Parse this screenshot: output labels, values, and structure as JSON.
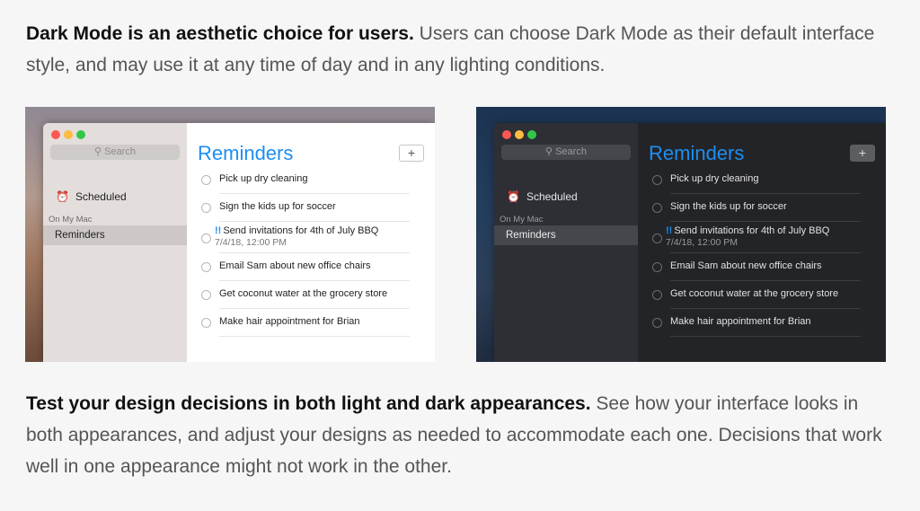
{
  "intro": {
    "bold": "Dark Mode is an aesthetic choice for users.",
    "text": " Users can choose Dark Mode as their default interface style, and may use it at any time of day and in any lighting conditions."
  },
  "outro": {
    "bold": "Test your design decisions in both light and dark appearances.",
    "text": " See how your interface looks in both appearances, and adjust your designs as needed to accommodate each one. Decisions that work well in one appearance might not work in the other."
  },
  "app": {
    "search_placeholder": "Search",
    "scheduled_label": "Scheduled",
    "group_label": "On My Mac",
    "selected_list": "Reminders",
    "title": "Reminders",
    "add_button": "+",
    "items": [
      {
        "text": "Pick up dry cleaning",
        "flag": "",
        "date": ""
      },
      {
        "text": "Sign the kids up for soccer",
        "flag": "",
        "date": ""
      },
      {
        "text": "Send invitations for 4th of July BBQ",
        "flag": "!!",
        "date": "7/4/18, 12:00 PM"
      },
      {
        "text": "Email Sam about new office chairs",
        "flag": "",
        "date": ""
      },
      {
        "text": "Get coconut water at the grocery store",
        "flag": "",
        "date": ""
      },
      {
        "text": "Make hair appointment for Brian",
        "flag": "",
        "date": ""
      }
    ]
  },
  "colors": {
    "accent": "#1d8ef2",
    "light_sidebar": "#e3dedb",
    "dark_sidebar": "#2d2f35",
    "dark_main": "#232427"
  }
}
